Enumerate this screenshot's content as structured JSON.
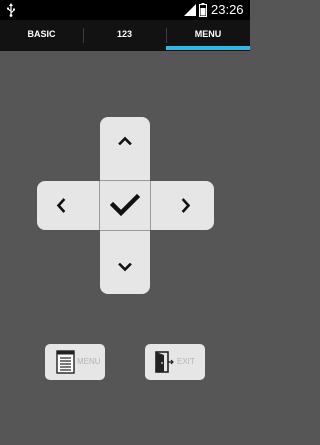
{
  "status_bar": {
    "time": "23:26",
    "icons": [
      "usb-icon",
      "signal-icon",
      "battery-icon"
    ]
  },
  "tabs": [
    {
      "label": "BASIC",
      "selected": false
    },
    {
      "label": "123",
      "selected": false
    },
    {
      "label": "MENU",
      "selected": true
    }
  ],
  "dpad": {
    "up_icon": "chevron-up-icon",
    "down_icon": "chevron-down-icon",
    "left_icon": "chevron-left-icon",
    "right_icon": "chevron-right-icon",
    "ok_icon": "checkmark-icon"
  },
  "buttons": {
    "menu_label": "MENU",
    "menu_icon": "list-icon",
    "exit_label": "EXIT",
    "exit_icon": "exit-door-icon"
  },
  "colors": {
    "background": "#565656",
    "tab_bar": "#121212",
    "tab_indicator": "#33b5e5",
    "button_face": "#e6e6e6",
    "icon_dark": "#111111",
    "label_muted": "#b4b4b4"
  }
}
